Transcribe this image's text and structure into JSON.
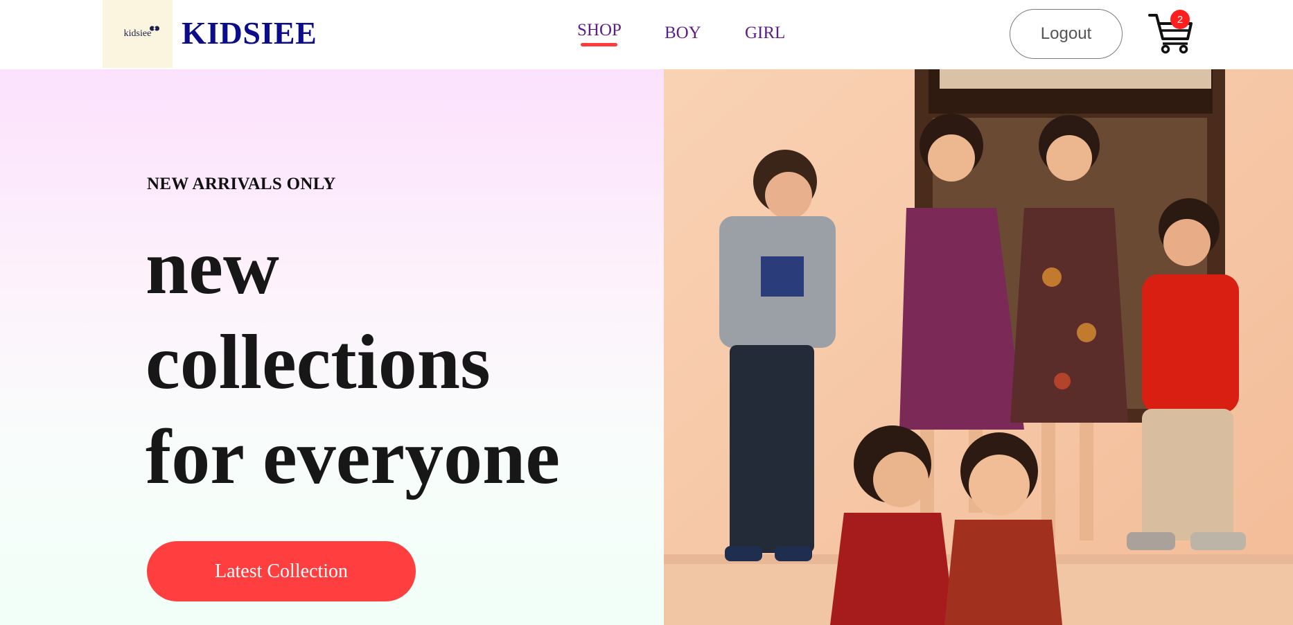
{
  "brand": {
    "logo_text": "kidsiee",
    "name": "KIDSIEE"
  },
  "nav": {
    "items": [
      {
        "label": "SHOP",
        "active": true
      },
      {
        "label": "BOY",
        "active": false
      },
      {
        "label": "GIRL",
        "active": false
      }
    ],
    "active_underline_color": "#ff3b3b",
    "link_color": "#5b1f86"
  },
  "header": {
    "logout_label": "Logout",
    "cart_icon": "cart-icon",
    "cart_count": "2"
  },
  "hero": {
    "eyebrow": "NEW ARRIVALS ONLY",
    "headline_lines": [
      "new",
      "collections",
      "for everyone"
    ],
    "cta_label": "Latest Collection",
    "cta_color": "#ff3f3f",
    "image": "photo of six smiling children in festive clothing against a peach wall"
  }
}
